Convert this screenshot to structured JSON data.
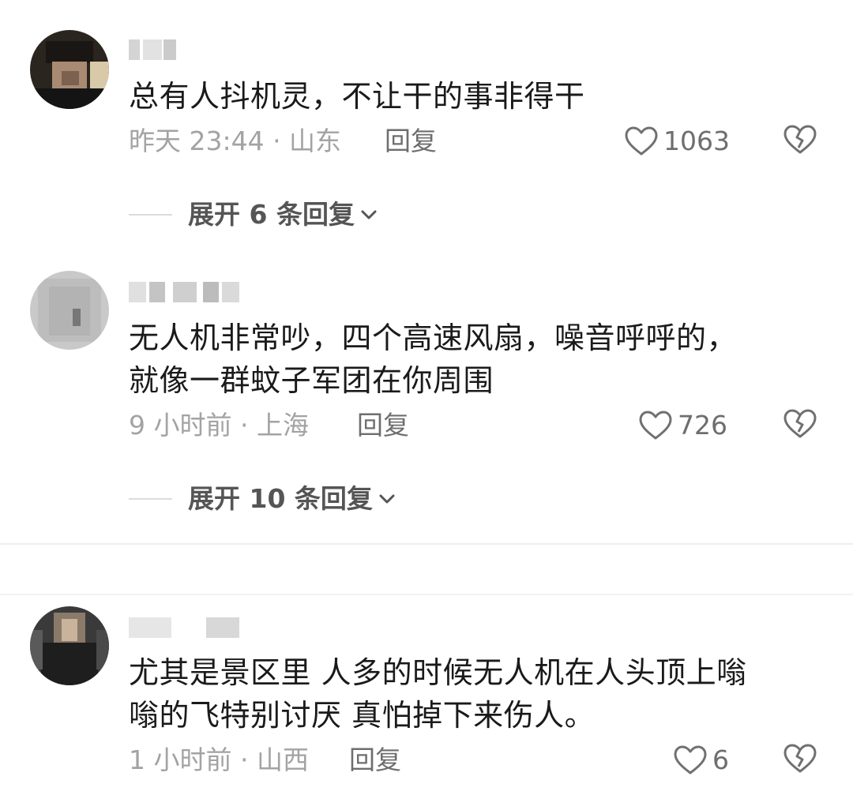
{
  "comments": [
    {
      "text_lines": [
        "总有人抖机灵，不让干的事非得干"
      ],
      "time_location": "昨天 23:44 · 山东",
      "reply_label": "回复",
      "likes": "1063",
      "expand_label": "展开 6 条回复"
    },
    {
      "text_lines": [
        "无人机非常吵，四个高速风扇，噪音呼呼的，",
        "就像一群蚊子军团在你周围"
      ],
      "time_location": "9 小时前 · 上海",
      "reply_label": "回复",
      "likes": "726",
      "expand_label": "展开 10 条回复"
    },
    {
      "text_lines": [
        "尤其是景区里 人多的时候无人机在人头顶上嗡",
        "嗡的飞特别讨厌   真怕掉下来伤人。"
      ],
      "time_location": "1 小时前 · 山西",
      "reply_label": "回复",
      "likes": "6"
    }
  ],
  "icons": {
    "like": "heart-outline-icon",
    "dislike": "broken-heart-icon",
    "expand": "chevron-down-icon"
  },
  "colors": {
    "primary_text": "#1a1a1a",
    "meta_text": "#a3a3a3",
    "action_text": "#6e6e6e",
    "divider": "#eeeeee"
  }
}
